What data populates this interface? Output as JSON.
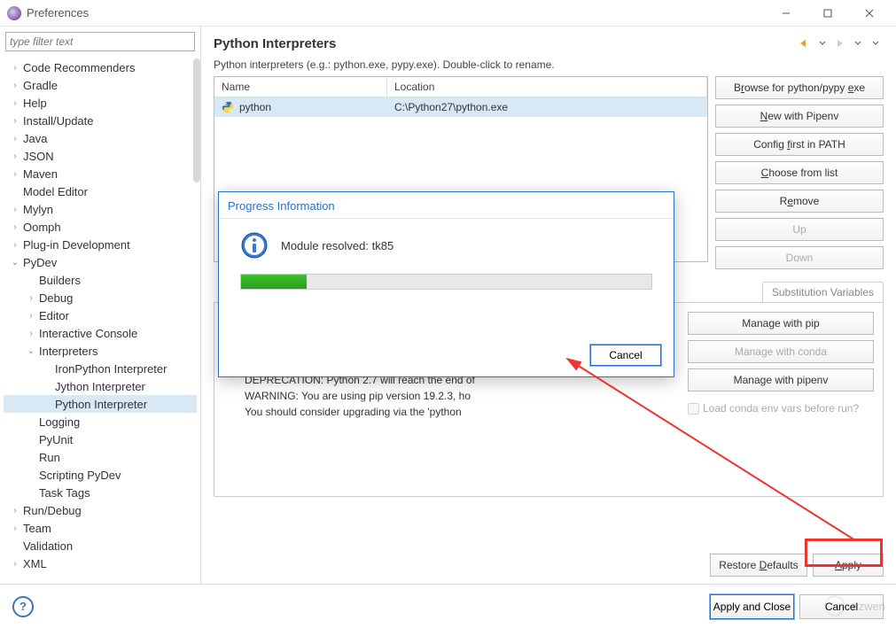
{
  "window": {
    "title": "Preferences"
  },
  "filter": {
    "placeholder": "type filter text"
  },
  "tree": [
    {
      "label": "Code Recommenders",
      "expandable": true,
      "expanded": false,
      "indent": 0
    },
    {
      "label": "Gradle",
      "expandable": true,
      "expanded": false,
      "indent": 0
    },
    {
      "label": "Help",
      "expandable": true,
      "expanded": false,
      "indent": 0
    },
    {
      "label": "Install/Update",
      "expandable": true,
      "expanded": false,
      "indent": 0
    },
    {
      "label": "Java",
      "expandable": true,
      "expanded": false,
      "indent": 0
    },
    {
      "label": "JSON",
      "expandable": true,
      "expanded": false,
      "indent": 0
    },
    {
      "label": "Maven",
      "expandable": true,
      "expanded": false,
      "indent": 0
    },
    {
      "label": "Model Editor",
      "expandable": false,
      "expanded": false,
      "indent": 0
    },
    {
      "label": "Mylyn",
      "expandable": true,
      "expanded": false,
      "indent": 0
    },
    {
      "label": "Oomph",
      "expandable": true,
      "expanded": false,
      "indent": 0
    },
    {
      "label": "Plug-in Development",
      "expandable": true,
      "expanded": false,
      "indent": 0
    },
    {
      "label": "PyDev",
      "expandable": true,
      "expanded": true,
      "indent": 0
    },
    {
      "label": "Builders",
      "expandable": false,
      "expanded": false,
      "indent": 1
    },
    {
      "label": "Debug",
      "expandable": true,
      "expanded": false,
      "indent": 1
    },
    {
      "label": "Editor",
      "expandable": true,
      "expanded": false,
      "indent": 1
    },
    {
      "label": "Interactive Console",
      "expandable": true,
      "expanded": false,
      "indent": 1
    },
    {
      "label": "Interpreters",
      "expandable": true,
      "expanded": true,
      "indent": 1
    },
    {
      "label": "IronPython Interpreter",
      "expandable": false,
      "expanded": false,
      "indent": 2
    },
    {
      "label": "Jython Interpreter",
      "expandable": false,
      "expanded": false,
      "indent": 2
    },
    {
      "label": "Python Interpreter",
      "expandable": false,
      "expanded": false,
      "indent": 2,
      "selected": true
    },
    {
      "label": "Logging",
      "expandable": false,
      "expanded": false,
      "indent": 1
    },
    {
      "label": "PyUnit",
      "expandable": false,
      "expanded": false,
      "indent": 1
    },
    {
      "label": "Run",
      "expandable": false,
      "expanded": false,
      "indent": 1
    },
    {
      "label": "Scripting PyDev",
      "expandable": false,
      "expanded": false,
      "indent": 1
    },
    {
      "label": "Task Tags",
      "expandable": false,
      "expanded": false,
      "indent": 1
    },
    {
      "label": "Run/Debug",
      "expandable": true,
      "expanded": false,
      "indent": 0
    },
    {
      "label": "Team",
      "expandable": true,
      "expanded": false,
      "indent": 0
    },
    {
      "label": "Validation",
      "expandable": false,
      "expanded": false,
      "indent": 0
    },
    {
      "label": "XML",
      "expandable": true,
      "expanded": false,
      "indent": 0
    }
  ],
  "main": {
    "title": "Python Interpreters",
    "description": "Python interpreters (e.g.: python.exe, pypy.exe).   Double-click to rename.",
    "table": {
      "headers": {
        "name": "Name",
        "location": "Location"
      },
      "rows": [
        {
          "name": "python",
          "location": "C:\\Python27\\python.exe",
          "selected": true
        }
      ]
    },
    "buttons": {
      "browse": "Browse for python/pypy exe",
      "new_pipenv": "New with Pipenv",
      "config_path": "Config first in PATH",
      "choose_list": "Choose from list",
      "remove": "Remove",
      "up": "Up",
      "down": "Down"
    },
    "tabs": {
      "subst": "Substitution Variables"
    },
    "packages": {
      "msgs": [
        "DEPRECATION: Python 2.7 will reach the end of",
        "WARNING: You are using pip version 19.2.3, ho",
        "You should consider upgrading via the 'python"
      ],
      "manage_pip": "Manage with pip",
      "manage_conda": "Manage with conda",
      "manage_pipenv": "Manage with pipenv",
      "load_conda": "Load conda env vars before run?"
    },
    "restore": "Restore Defaults",
    "apply": "Apply"
  },
  "footer": {
    "apply_close": "Apply and Close",
    "cancel": "Cancel"
  },
  "dialog": {
    "title": "Progress Information",
    "message": "Module resolved: tk85",
    "cancel": "Cancel",
    "progress_pct": 16
  },
  "watermark": "ezwen"
}
